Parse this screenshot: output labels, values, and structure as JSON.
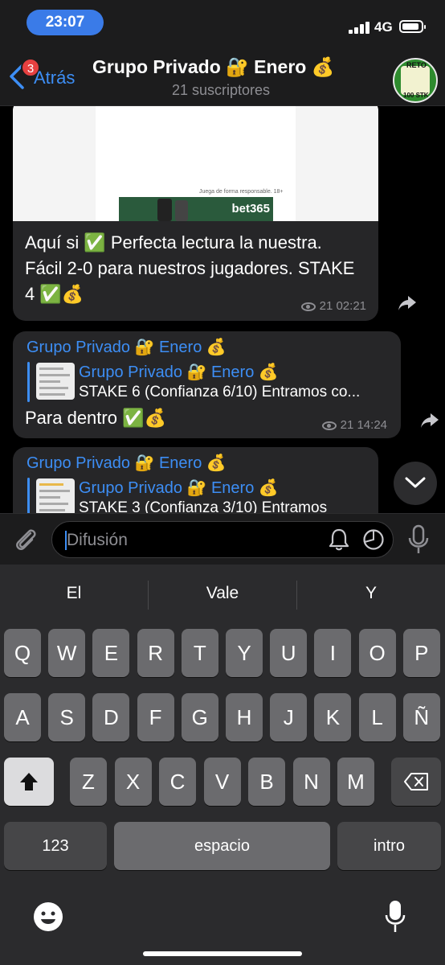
{
  "status": {
    "time": "23:07",
    "network": "4G"
  },
  "header": {
    "back_label": "Atrás",
    "unread_badge": "3",
    "title": "Grupo Privado 🔐 Enero 💰",
    "subtitle": "21 suscriptores",
    "avatar_top": "RETO",
    "avatar_bottom": "100 STK"
  },
  "messages": [
    {
      "image_ad_brand": "bet365",
      "image_ad_text": "Juega de forma responsable. 18+",
      "text": "Aquí si ✅ Perfecta lectura la nuestra. Fácil 2-0 para nuestros jugadores. STAKE 4 ✅💰",
      "views_time": "21 02:21"
    },
    {
      "forwarded_from": "Grupo Privado 🔐 Enero 💰",
      "reply_title": "Grupo Privado 🔐 Enero 💰",
      "reply_text": "STAKE 6 (Confianza 6/10) Entramos co...",
      "text": "Para dentro ✅💰",
      "views_time": "21 14:24"
    },
    {
      "forwarded_from": "Grupo Privado 🔐 Enero 💰",
      "reply_title": "Grupo Privado 🔐 Enero 💰",
      "reply_text": "STAKE 3 (Confianza 3/10) Entramos"
    }
  ],
  "composer": {
    "placeholder": "Difusión"
  },
  "keyboard": {
    "suggestions": [
      "El",
      "Vale",
      "Y"
    ],
    "row1": [
      "Q",
      "W",
      "E",
      "R",
      "T",
      "Y",
      "U",
      "I",
      "O",
      "P"
    ],
    "row2": [
      "A",
      "S",
      "D",
      "F",
      "G",
      "H",
      "J",
      "K",
      "L",
      "Ñ"
    ],
    "row3": [
      "Z",
      "X",
      "C",
      "V",
      "B",
      "N",
      "M"
    ],
    "numbers_label": "123",
    "space_label": "espacio",
    "return_label": "intro"
  },
  "colors": {
    "accent": "#3d8ef5",
    "bubble": "#262628",
    "badge": "#e64040"
  }
}
